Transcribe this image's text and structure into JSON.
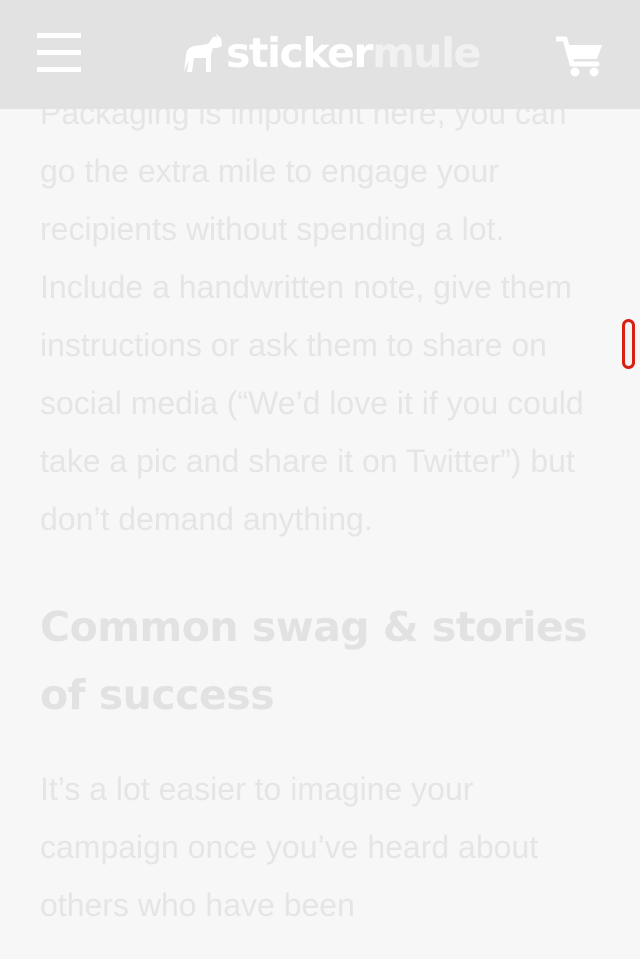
{
  "header": {
    "menu_icon": "hamburger-menu-icon",
    "logo": {
      "part1": "sticker",
      "part2": "mule",
      "icon": "mule-icon"
    },
    "cart_icon": "shopping-cart-icon"
  },
  "article": {
    "paragraph1": "Packaging is important here, you can go the extra mile to engage your recipients without spending a lot. Include a handwritten note, give them instructions or ask them to share on social media (“We’d love it if you could take a pic and share it on Twitter”) but don’t demand anything.",
    "heading": "Common swag & stories of success",
    "paragraph2": "It’s a lot easier to imagine your campaign once you’ve heard about others who have been"
  },
  "colors": {
    "header_bg": "#e2e2e2",
    "page_bg": "#f7f7f7",
    "text": "#e5e5e5",
    "widget_border": "#d91f12"
  }
}
